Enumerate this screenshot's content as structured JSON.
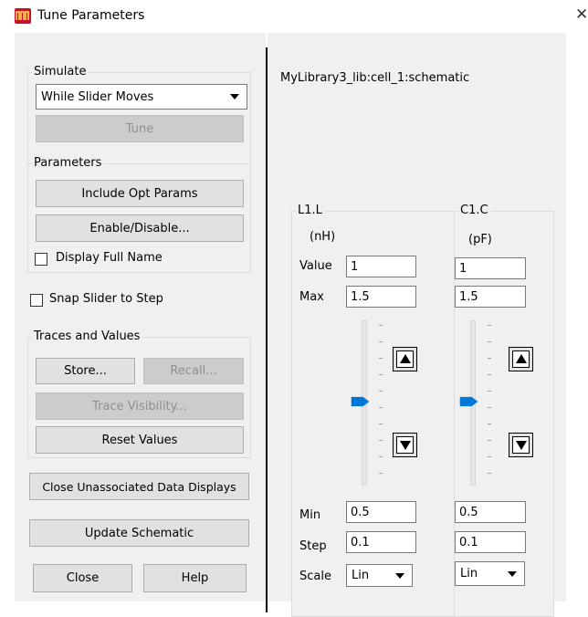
{
  "window": {
    "title": "Tune Parameters",
    "close_glyph": "✕",
    "accent": "#c8102e"
  },
  "simulate": {
    "group_label": "Simulate",
    "mode_value": "While Slider Moves",
    "tune_label": "Tune"
  },
  "parameters": {
    "group_label": "Parameters",
    "include_opt_label": "Include Opt Params",
    "enable_disable_label": "Enable/Disable...",
    "display_full_name_label": "Display Full Name",
    "display_full_name_checked": false
  },
  "snap_slider_label": "Snap Slider to Step",
  "snap_slider_checked": false,
  "traces": {
    "group_label": "Traces and Values",
    "store_label": "Store...",
    "recall_label": "Recall...",
    "trace_visibility_label": "Trace Visibility...",
    "reset_values_label": "Reset Values"
  },
  "close_unassociated_label": "Close Unassociated Data Displays",
  "update_schematic_label": "Update Schematic",
  "close_label": "Close",
  "help_label": "Help",
  "design_name": "MyLibrary3_lib:cell_1:schematic",
  "param_labels": {
    "value": "Value",
    "max": "Max",
    "min": "Min",
    "step": "Step",
    "scale": "Scale"
  },
  "params": [
    {
      "name": "L1.L",
      "unit": "(nH)",
      "value": "1",
      "max": "1.5",
      "min": "0.5",
      "step": "0.1",
      "scale": "Lin",
      "slider_fraction": 0.5
    },
    {
      "name": "C1.C",
      "unit": "(pF)",
      "value": "1",
      "max": "1.5",
      "min": "0.5",
      "step": "0.1",
      "scale": "Lin",
      "slider_fraction": 0.5
    }
  ],
  "icons": {
    "app": "app-logo-icon",
    "close": "close-icon",
    "dropdown": "chevron-down-icon",
    "step_up": "triangle-up-icon",
    "step_down": "triangle-down-icon",
    "thumb": "slider-thumb-icon"
  },
  "colors": {
    "thumb": "#0078d7",
    "panel": "#f0f0f0",
    "divider": "#000000"
  }
}
